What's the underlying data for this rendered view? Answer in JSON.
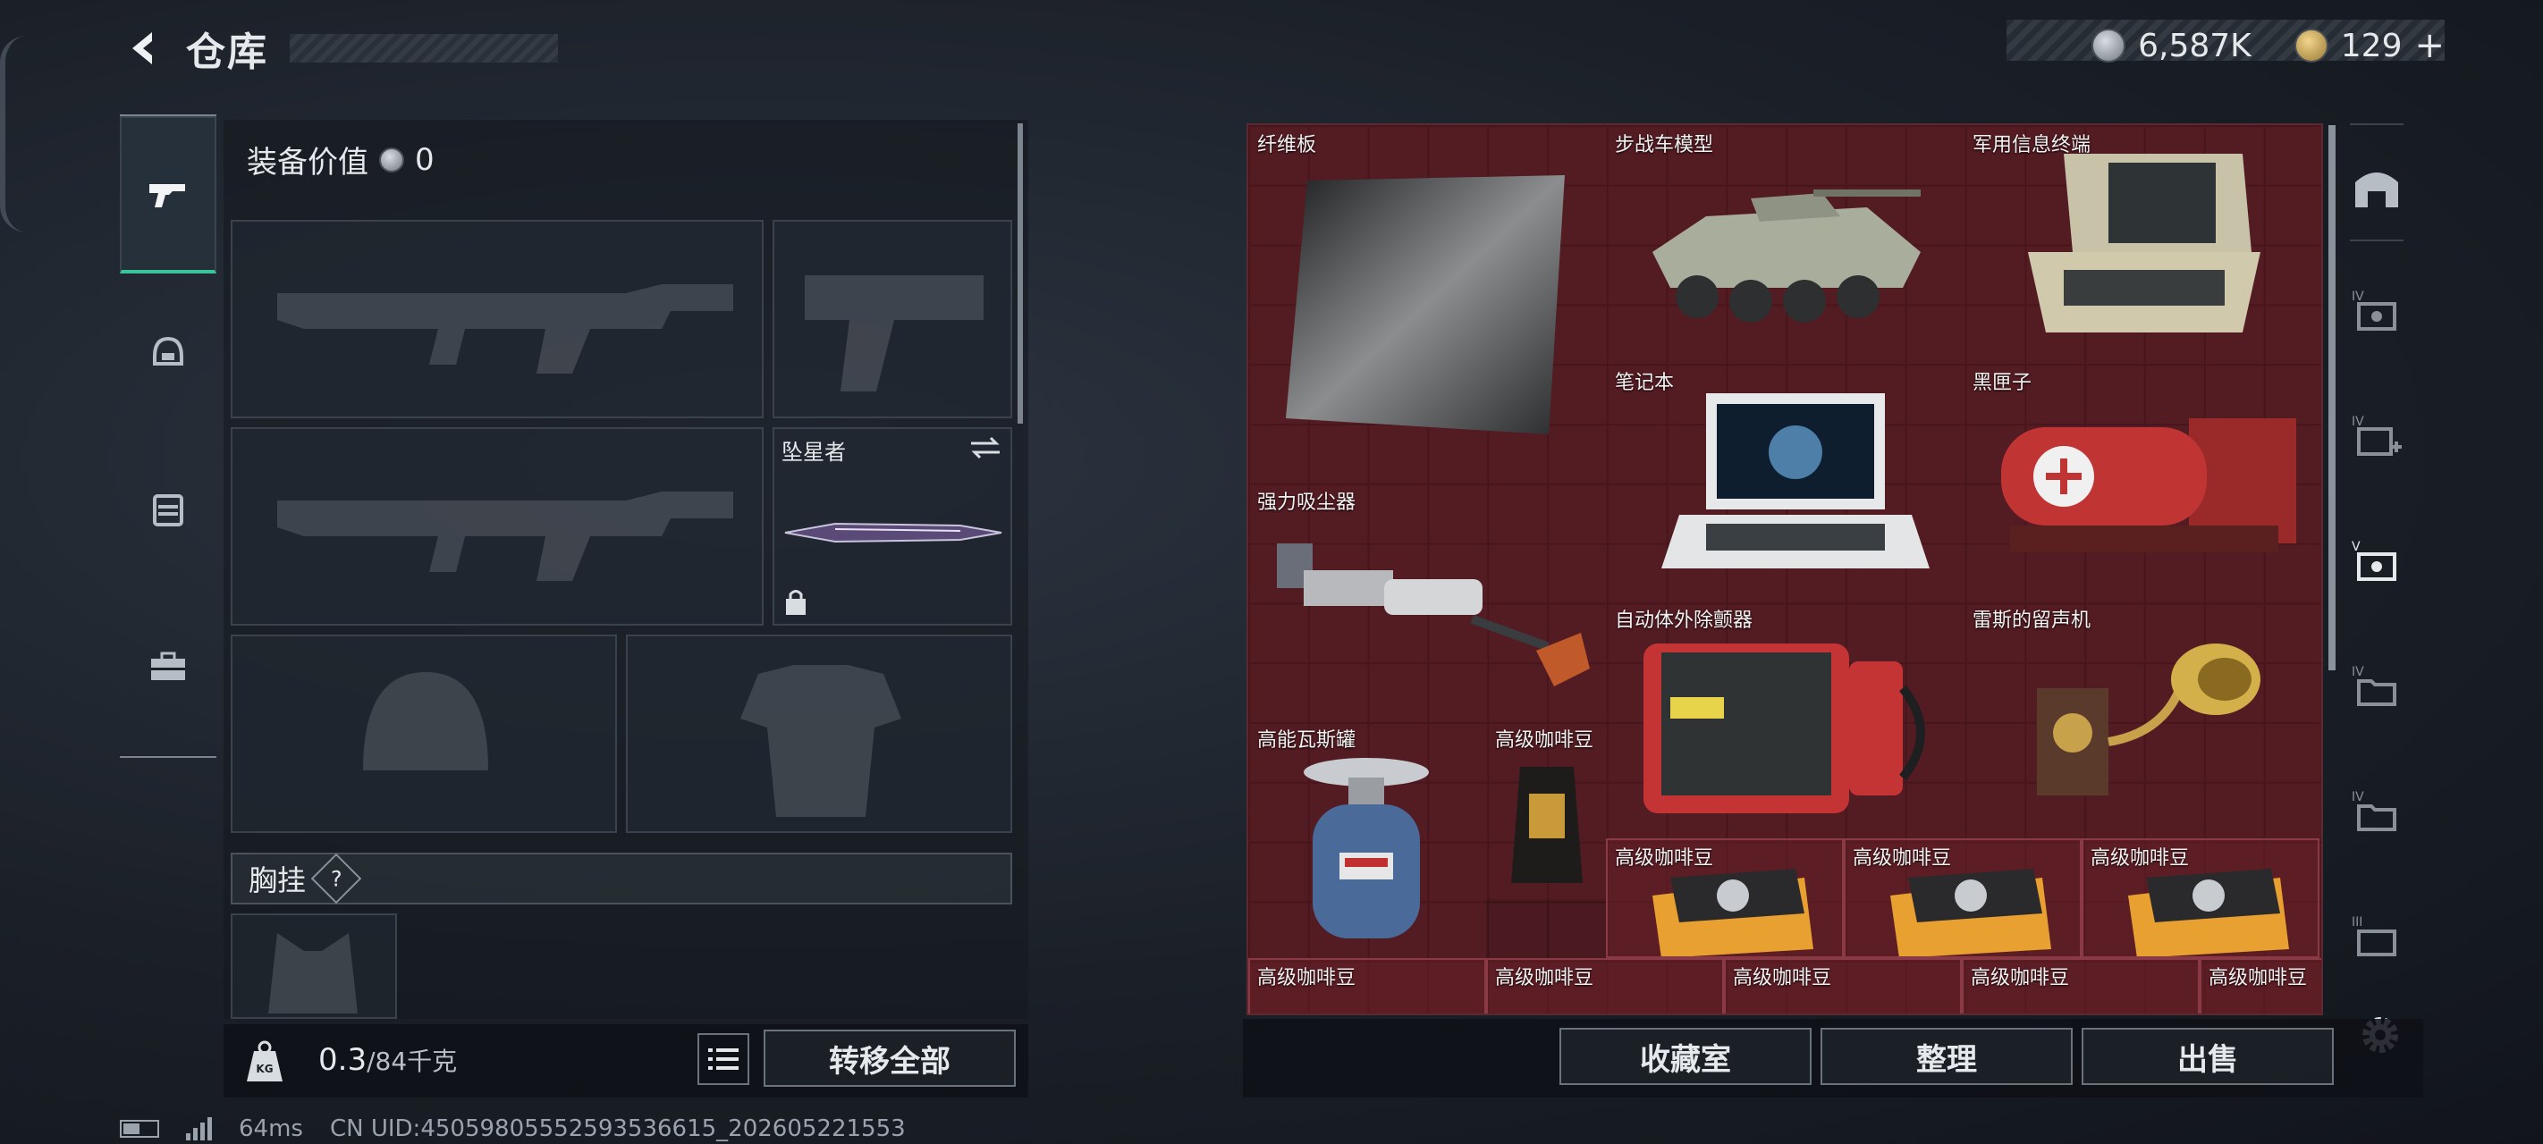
{
  "header": {
    "title": "仓库"
  },
  "currency": {
    "silver": "6,587K",
    "gold": "129",
    "plus": "+"
  },
  "side_nav": [
    {
      "icon": "pistol-icon",
      "active": true
    },
    {
      "icon": "helmet-icon",
      "active": false
    },
    {
      "icon": "vest-icon",
      "active": false
    },
    {
      "icon": "toolbox-icon",
      "active": false
    }
  ],
  "equipment": {
    "value_label": "装备价值",
    "value": "0",
    "melee_name": "坠星者",
    "chest_label": "胸挂",
    "help": "?"
  },
  "weight": {
    "current": "0.3",
    "max": "/84千克",
    "icon_text": "KG"
  },
  "buttons": {
    "transfer_all": "转移全部",
    "collection": "收藏室",
    "sort": "整理",
    "sell": "出售"
  },
  "inventory": {
    "items": [
      {
        "name": "纤维板"
      },
      {
        "name": "步战车模型"
      },
      {
        "name": "军用信息终端"
      },
      {
        "name": "笔记本"
      },
      {
        "name": "黑匣子"
      },
      {
        "name": "强力吸尘器"
      },
      {
        "name": "自动体外除颤器"
      },
      {
        "name": "雷斯的留声机"
      },
      {
        "name": "高能瓦斯罐"
      },
      {
        "name": "高级咖啡豆"
      },
      {
        "name": "高级咖啡豆"
      },
      {
        "name": "高级咖啡豆"
      },
      {
        "name": "高级咖啡豆"
      },
      {
        "name": "高级咖啡豆"
      },
      {
        "name": "高级咖啡豆"
      },
      {
        "name": "高级咖啡豆"
      },
      {
        "name": "高级咖啡豆"
      },
      {
        "name": "高级咖啡豆"
      }
    ]
  },
  "right_rail": {
    "tiers": [
      "IV",
      "IV",
      "V",
      "IV",
      "IV",
      "III"
    ]
  },
  "status": {
    "ping": "64ms",
    "uid": "CN UID:4505980555259353661​5_202605221553"
  }
}
